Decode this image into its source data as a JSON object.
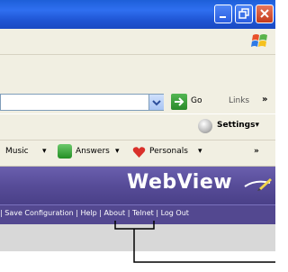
{
  "window": {
    "controls": [
      "minimize",
      "maximize",
      "close"
    ]
  },
  "address_bar": {
    "go_label": "Go",
    "links_label": "Links",
    "links_chevron": "»"
  },
  "settings": {
    "label": "Settings"
  },
  "links_toolbar": {
    "items": [
      {
        "label": "Music",
        "has_dropdown": true
      },
      {
        "label": "Answers",
        "has_dropdown": true,
        "icon": "answers-icon"
      },
      {
        "label": "Personals",
        "has_dropdown": true,
        "icon": "heart-icon"
      }
    ],
    "dropdown_glyph": "▾",
    "overflow": "»"
  },
  "app": {
    "brand": "WebView",
    "nav": {
      "leading_sep": "|",
      "items": [
        "Save Configuration",
        "Help",
        "About",
        "Telnet",
        "Log Out"
      ],
      "sep": "|"
    }
  },
  "colors": {
    "banner": "#5a4f9c",
    "navbar": "#534890",
    "chrome": "#f1efe2",
    "titlebar": "#2458d8"
  }
}
